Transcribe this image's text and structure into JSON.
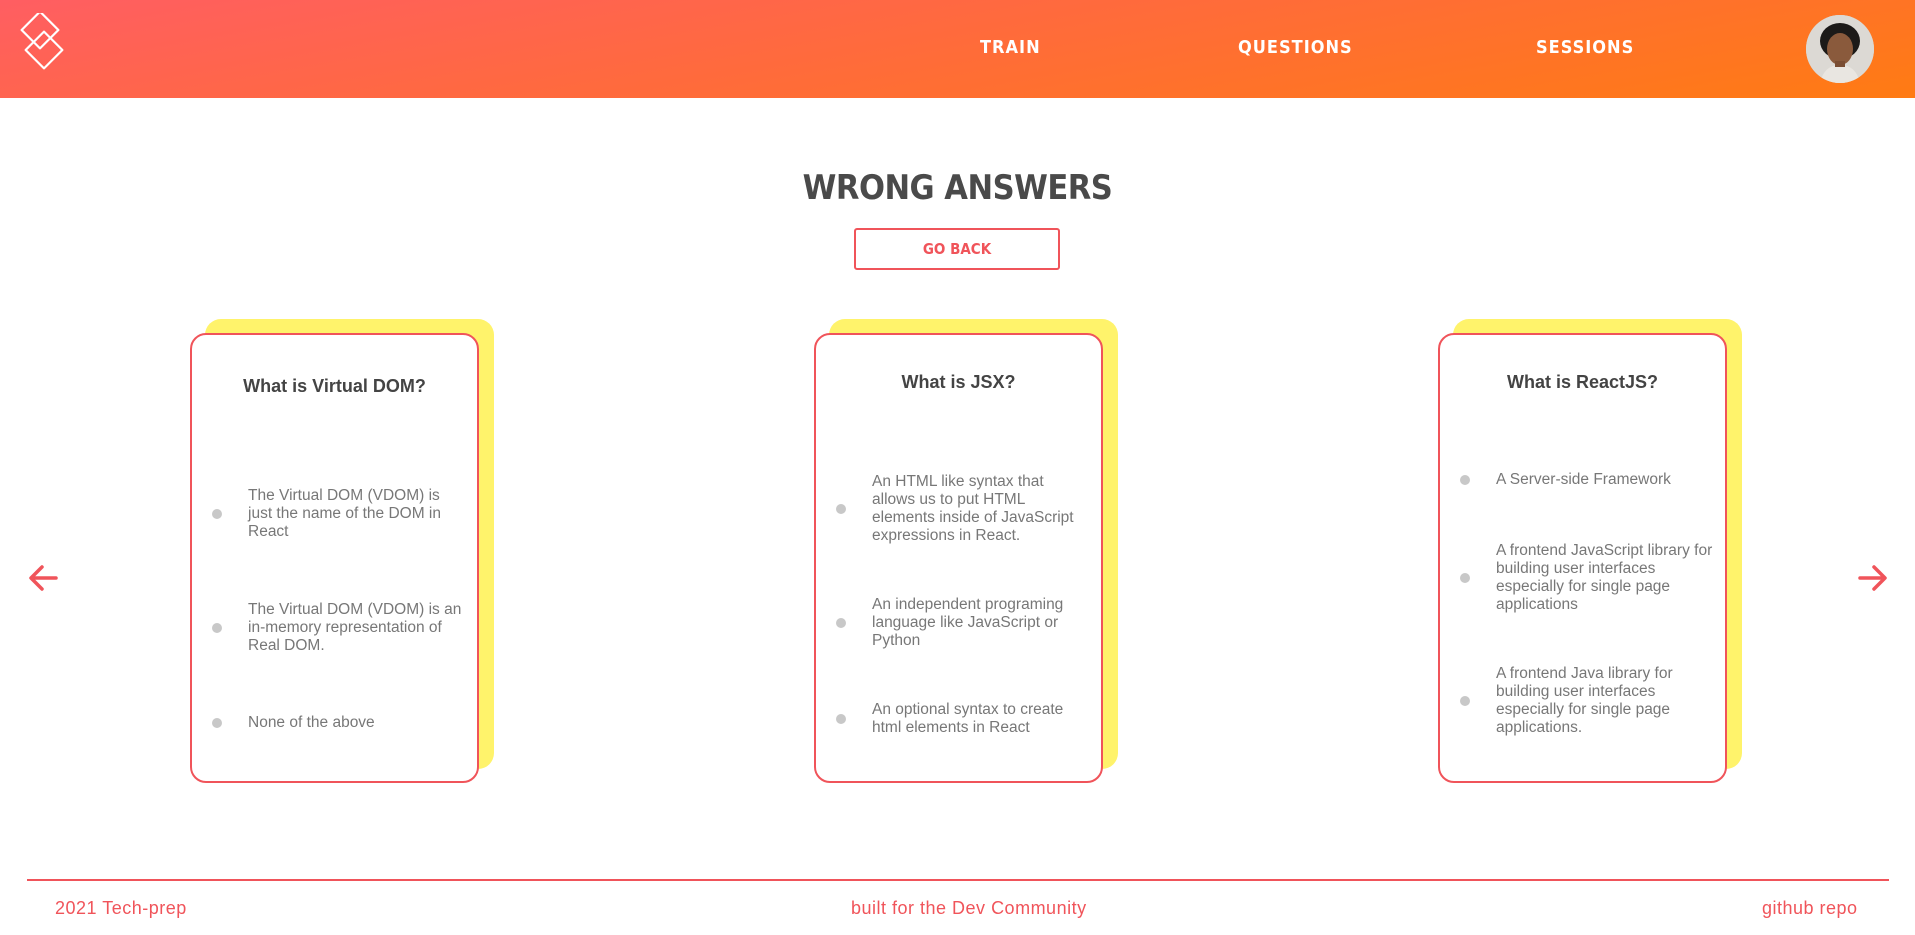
{
  "nav": {
    "logo_icon": "diamond-logo-icon",
    "links": [
      {
        "label": "TRAIN"
      },
      {
        "label": "QUESTIONS"
      },
      {
        "label": "SESSIONS"
      }
    ],
    "avatar_icon": "user-avatar"
  },
  "page": {
    "title": "WRONG ANSWERS",
    "go_back_label": "GO BACK"
  },
  "cards": [
    {
      "question": "What is Virtual DOM?",
      "options": [
        "The Virtual DOM (VDOM) is just the name of the DOM in React",
        "The Virtual DOM (VDOM) is an in-memory representation of Real DOM.",
        "None of the above"
      ]
    },
    {
      "question": "What is JSX?",
      "options": [
        "An HTML like syntax that allows us to put HTML elements inside of JavaScript expressions in React.",
        "An independent programing language like JavaScript or Python",
        "An optional syntax to create html elements in React"
      ]
    },
    {
      "question": "What is ReactJS?",
      "options": [
        "A Server-side Framework",
        "A frontend JavaScript library for building user interfaces especially for single page applications",
        "A frontend Java library for building user interfaces especially for single page applications."
      ]
    }
  ],
  "carousel": {
    "prev_icon": "arrow-left-icon",
    "next_icon": "arrow-right-icon"
  },
  "footer": {
    "left": "2021 Tech-prep",
    "center": "built for the Dev Community",
    "right": "github repo"
  },
  "colors": {
    "accent": "#f0545a",
    "header_start": "#ff5e62",
    "header_end": "#ff7b13",
    "card_shadow": "#fff36b"
  }
}
